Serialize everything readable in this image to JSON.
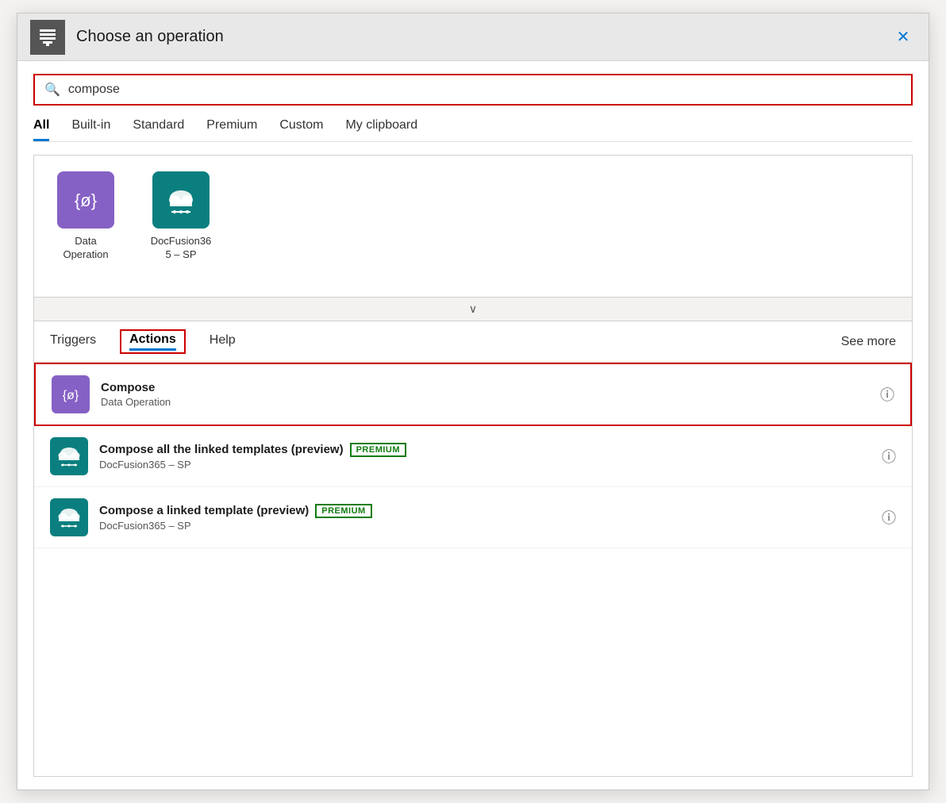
{
  "dialog": {
    "title": "Choose an operation",
    "close_label": "✕"
  },
  "search": {
    "placeholder": "compose",
    "value": "compose"
  },
  "filter_tabs": [
    {
      "id": "all",
      "label": "All",
      "active": true
    },
    {
      "id": "builtin",
      "label": "Built-in",
      "active": false
    },
    {
      "id": "standard",
      "label": "Standard",
      "active": false
    },
    {
      "id": "premium",
      "label": "Premium",
      "active": false
    },
    {
      "id": "custom",
      "label": "Custom",
      "active": false
    },
    {
      "id": "myclipboard",
      "label": "My clipboard",
      "active": false
    }
  ],
  "connectors": [
    {
      "id": "data-operation",
      "label": "Data\nOperation",
      "icon_type": "purple",
      "icon_char": "{ø}"
    },
    {
      "id": "docfusion365-sp",
      "label": "DocFusion36\n5 – SP",
      "icon_type": "teal",
      "icon_char": "cloud"
    }
  ],
  "collapse_icon": "∨",
  "actions_tabs": [
    {
      "id": "triggers",
      "label": "Triggers",
      "active": false
    },
    {
      "id": "actions",
      "label": "Actions",
      "active": true
    },
    {
      "id": "help",
      "label": "Help",
      "active": false
    }
  ],
  "see_more": "See more",
  "results": [
    {
      "id": "compose",
      "title": "Compose",
      "subtitle": "Data Operation",
      "icon_type": "purple",
      "icon_char": "{ø}",
      "premium": false,
      "highlighted": true
    },
    {
      "id": "compose-all-linked",
      "title": "Compose all the linked templates (preview)",
      "subtitle": "DocFusion365 – SP",
      "icon_type": "teal",
      "icon_char": "cloud",
      "premium": true,
      "highlighted": false
    },
    {
      "id": "compose-linked-template",
      "title": "Compose a linked template (preview)",
      "subtitle": "DocFusion365 – SP",
      "icon_type": "teal",
      "icon_char": "cloud",
      "premium": true,
      "highlighted": false
    }
  ],
  "badges": {
    "premium_label": "PREMIUM"
  }
}
